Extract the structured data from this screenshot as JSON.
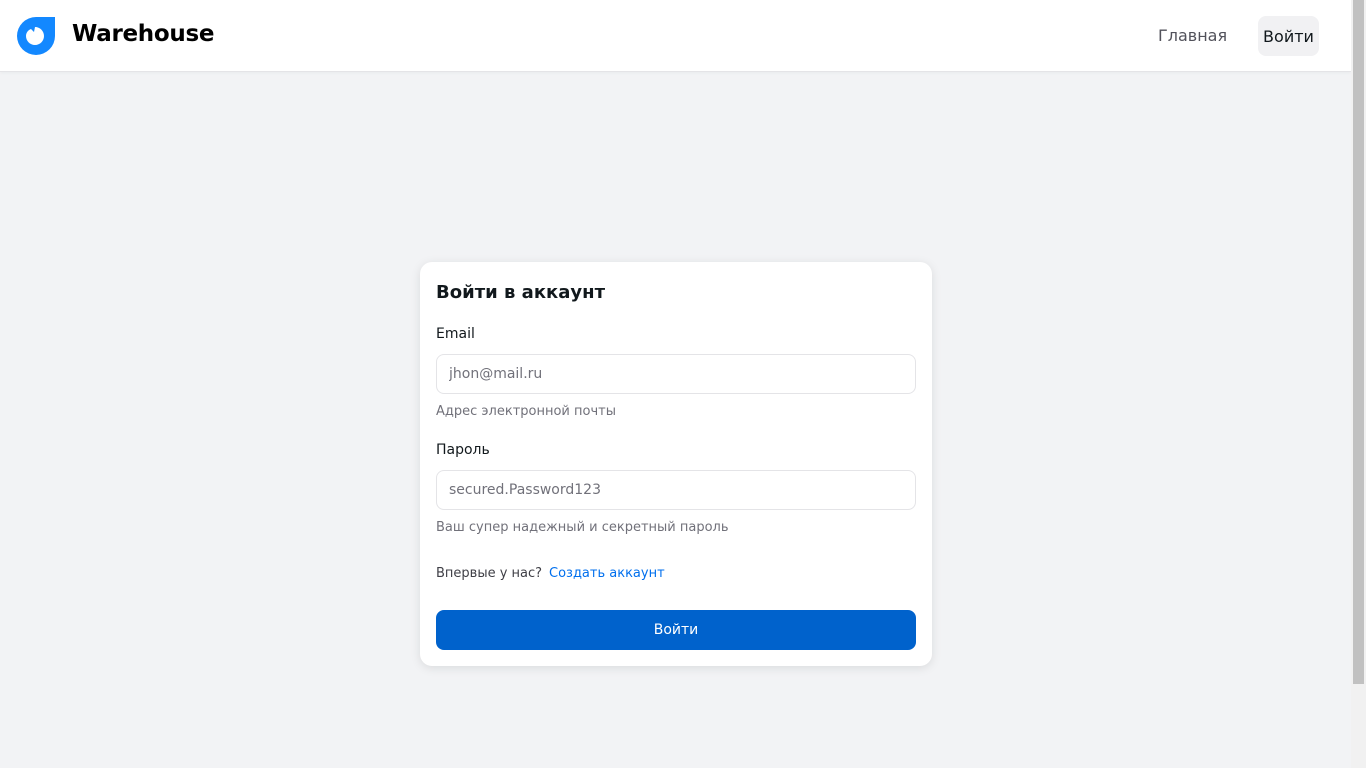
{
  "header": {
    "brand": "Warehouse",
    "logo_icon": "droplet-logo-icon",
    "nav": {
      "home_label": "Главная",
      "login_label": "Войти"
    }
  },
  "login_form": {
    "title": "Войти в аккаунт",
    "email": {
      "label": "Email",
      "value": "",
      "placeholder": "jhon@mail.ru",
      "help": "Адрес электронной почты"
    },
    "password": {
      "label": "Пароль",
      "value": "",
      "placeholder": "secured.Password123",
      "help": "Ваш супер надежный и секретный пароль"
    },
    "signup_prompt": "Впервые у нас?",
    "signup_link": "Создать аккаунт",
    "submit_label": "Войти"
  },
  "colors": {
    "accent": "#0062cc",
    "link": "#006fee",
    "logo": "#1388ff",
    "background": "#f2f3f5"
  }
}
